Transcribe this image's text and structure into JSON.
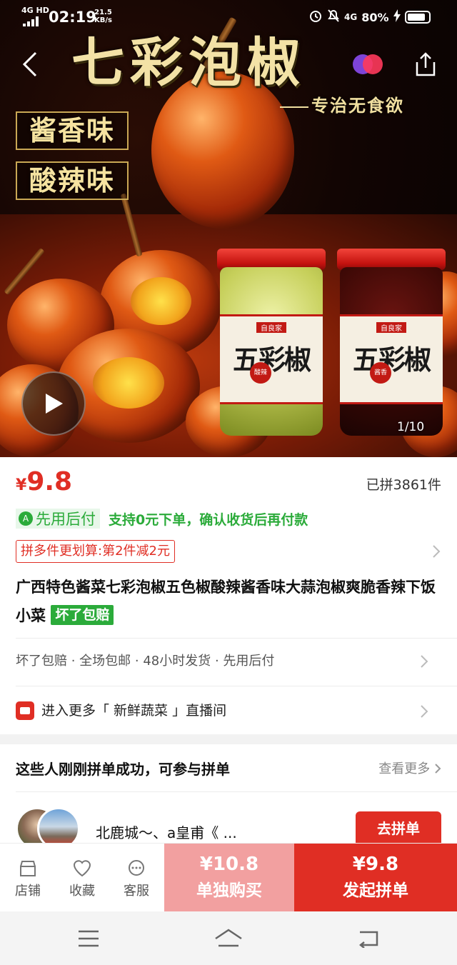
{
  "status_bar": {
    "network": "4G HD",
    "time": "02:19",
    "speed_value": "21.5",
    "speed_unit": "KB/s",
    "network_right": "4G",
    "battery": "80%"
  },
  "hero": {
    "title": "七彩泡椒",
    "slogan": "专治无食欲",
    "flavor_1": "酱香味",
    "flavor_2": "酸辣味",
    "jar_brand": "自良家",
    "jar_name": "五彩椒",
    "jar_a_stamp": "酸辣",
    "jar_b_stamp": "酱香",
    "page_indicator": "1/10"
  },
  "product": {
    "currency": "¥",
    "price": "9.8",
    "sold": "已拼3861件",
    "pay_later_tag": "先用后付",
    "pay_later_icon": "A",
    "pay_later_desc": "支持0元下单，确认收货后再付款",
    "promo": "拼多件更划算:第2件减2元",
    "title": "广西特色酱菜七彩泡椒五色椒酸辣酱香味大蒜泡椒爽脆香辣下饭小菜",
    "title_badge": "坏了包赔",
    "services": "坏了包赔 · 全场包邮 · 48小时发货 · 先用后付",
    "live_room": "进入更多「 新鲜蔬菜 」直播间"
  },
  "group_buy": {
    "heading": "这些人刚刚拼单成功，可参与拼单",
    "more": "查看更多",
    "names": "北鹿城～、a皇甫《 ...",
    "join_label": "去拼单"
  },
  "action_bar": {
    "shop": "店铺",
    "favorite": "收藏",
    "service": "客服",
    "single_price": "¥10.8",
    "single_label": "单独购买",
    "group_price": "¥9.8",
    "group_label": "发起拼单"
  },
  "colors": {
    "accent": "#e02e24",
    "green": "#2bab3a",
    "single_buy_bg": "#f2a0a0"
  },
  "icons": [
    "back-icon",
    "share-icon",
    "play-icon",
    "chevron-right-icon",
    "live-tv-icon",
    "store-icon",
    "heart-icon",
    "chat-icon",
    "menu-icon",
    "home-icon",
    "return-icon"
  ]
}
